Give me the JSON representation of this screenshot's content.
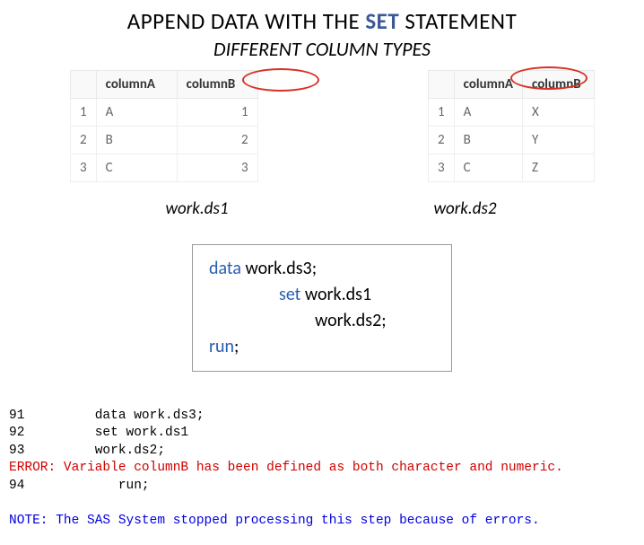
{
  "title": {
    "pre": "APPEND DATA WITH THE ",
    "highlight": "SET",
    "post": " STATEMENT",
    "subtitle": "DIFFERENT COLUMN TYPES"
  },
  "table1": {
    "headers": {
      "colA": "columnA",
      "colB": "columnB"
    },
    "rows": [
      {
        "n": "1",
        "a": "A",
        "b": "1"
      },
      {
        "n": "2",
        "a": "B",
        "b": "2"
      },
      {
        "n": "3",
        "a": "C",
        "b": "3"
      }
    ],
    "caption": "work.ds1"
  },
  "table2": {
    "headers": {
      "colA": "columnA",
      "colB": "columnB"
    },
    "rows": [
      {
        "n": "1",
        "a": "A",
        "b": "X"
      },
      {
        "n": "2",
        "a": "B",
        "b": "Y"
      },
      {
        "n": "3",
        "a": "C",
        "b": "Z"
      }
    ],
    "caption": "work.ds2"
  },
  "code": {
    "kw1": "data",
    "line1rest": " work.ds3;",
    "kw2": "set",
    "line2rest": " work.ds1",
    "line3": "work.ds2;",
    "kw3": "run",
    "line4rest": ";"
  },
  "log": {
    "l1": "91         data work.ds3;",
    "l2": "92         set work.ds1",
    "l3": "93         work.ds2;",
    "err": "ERROR: Variable columnB has been defined as both character and numeric.",
    "l4": "94            run;",
    "note": "NOTE: The SAS System stopped processing this step because of errors."
  }
}
